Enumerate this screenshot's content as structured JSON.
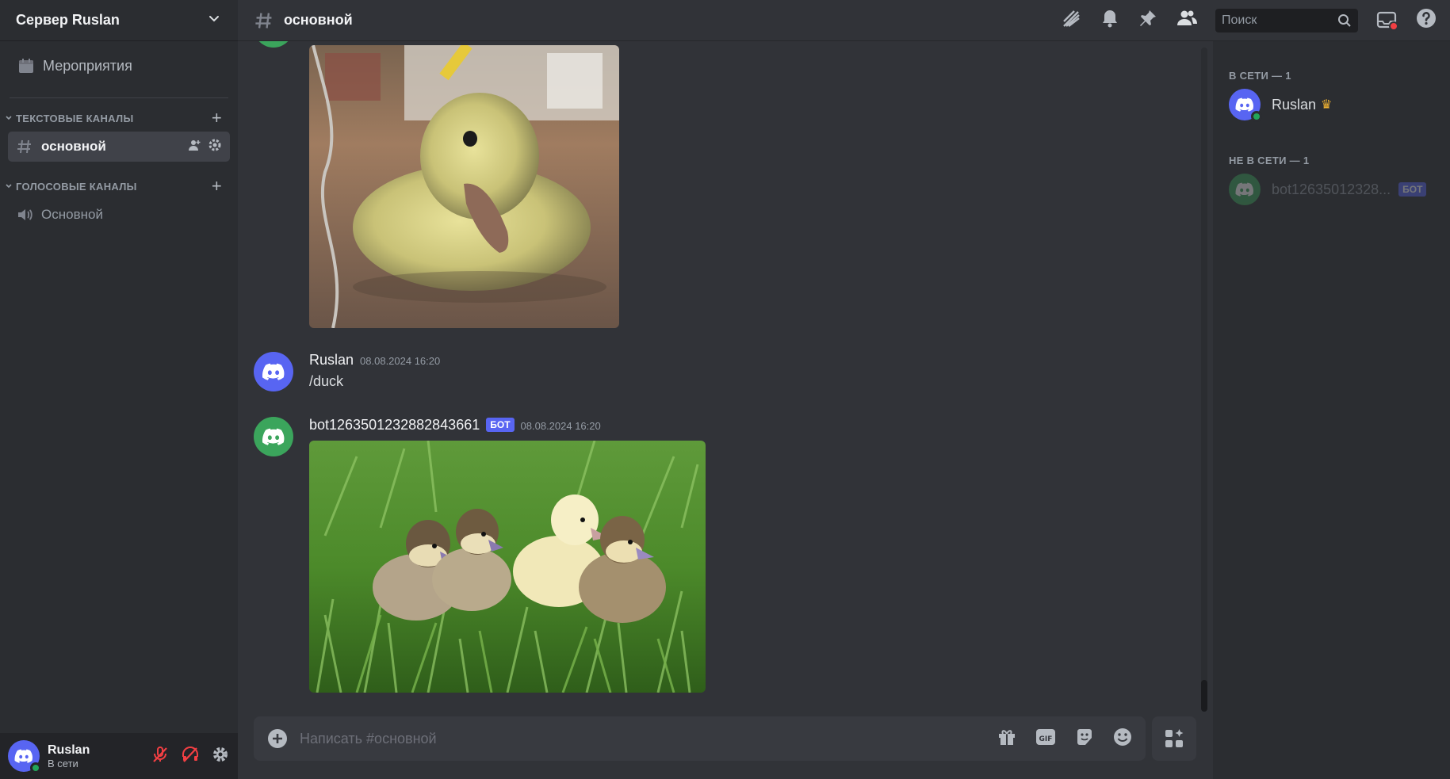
{
  "server": {
    "name": "Сервер Ruslan"
  },
  "sidebar": {
    "events_label": "Мероприятия",
    "categories": [
      {
        "label": "Текстовые каналы",
        "channels": [
          {
            "name": "основной",
            "type": "text",
            "active": true
          }
        ]
      },
      {
        "label": "Голосовые каналы",
        "channels": [
          {
            "name": "Основной",
            "type": "voice",
            "active": false
          }
        ]
      }
    ]
  },
  "header": {
    "channel_name": "основной",
    "search_placeholder": "Поиск"
  },
  "messages": [
    {
      "type": "image-continuation",
      "image": "duckling-on-floor"
    },
    {
      "author": "Ruslan",
      "timestamp": "08.08.2024 16:20",
      "text": "/duck",
      "avatar_color": "#5865f2"
    },
    {
      "author": "bot1263501232882843661",
      "badge": "БОТ",
      "timestamp": "08.08.2024 16:20",
      "image": "ducklings-in-grass",
      "avatar_color": "#3ba55c"
    }
  ],
  "composer": {
    "placeholder": "Написать #основной"
  },
  "members": {
    "online_header": "В сети — 1",
    "offline_header": "Не в сети — 1",
    "online": [
      {
        "name": "Ruslan",
        "owner": true,
        "avatar_color": "#5865f2"
      }
    ],
    "offline": [
      {
        "name": "bot12635012328...",
        "badge": "БОТ",
        "avatar_color": "#3ba55c"
      }
    ]
  },
  "user_panel": {
    "name": "Ruslan",
    "status": "В сети"
  },
  "colors": {
    "accent": "#5865f2",
    "online": "#23a55a",
    "bot_avatar": "#3ba55c",
    "muted_red": "#f23f43"
  }
}
